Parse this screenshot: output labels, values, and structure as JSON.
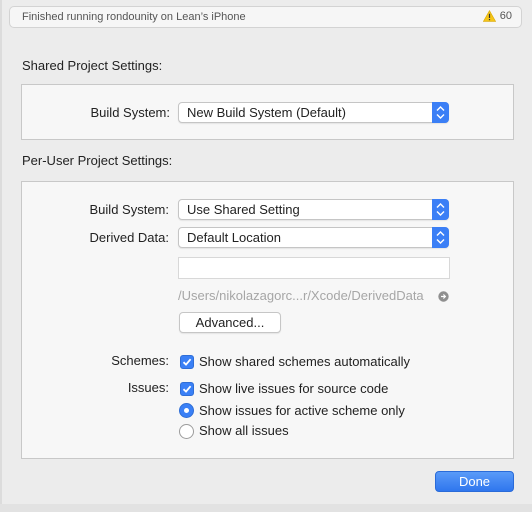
{
  "status": {
    "text": "Finished running rondounity on Lean’s iPhone",
    "warning_count": "60",
    "warning_icon": "warning-triangle-icon"
  },
  "shared": {
    "title": "Shared Project Settings:",
    "build_system_label": "Build System:",
    "build_system_value": "New Build System (Default)"
  },
  "per_user": {
    "title": "Per-User Project Settings:",
    "build_system_label": "Build System:",
    "build_system_value": "Use Shared Setting",
    "derived_data_label": "Derived Data:",
    "derived_data_value": "Default Location",
    "custom_path_value": "",
    "derived_path": "/Users/nikolazagorc...r/Xcode/DerivedData",
    "advanced_label": "Advanced...",
    "schemes_label": "Schemes:",
    "schemes_option": "Show shared schemes automatically",
    "schemes_checked": true,
    "issues_label": "Issues:",
    "issues_live_option": "Show live issues for source code",
    "issues_live_checked": true,
    "issues_scope_active": "Show issues for active scheme only",
    "issues_scope_all": "Show all issues",
    "issues_scope_selected": "active"
  },
  "footer": {
    "done_label": "Done"
  },
  "colors": {
    "accent": "#3a80f6",
    "warning": "#f5c518"
  }
}
